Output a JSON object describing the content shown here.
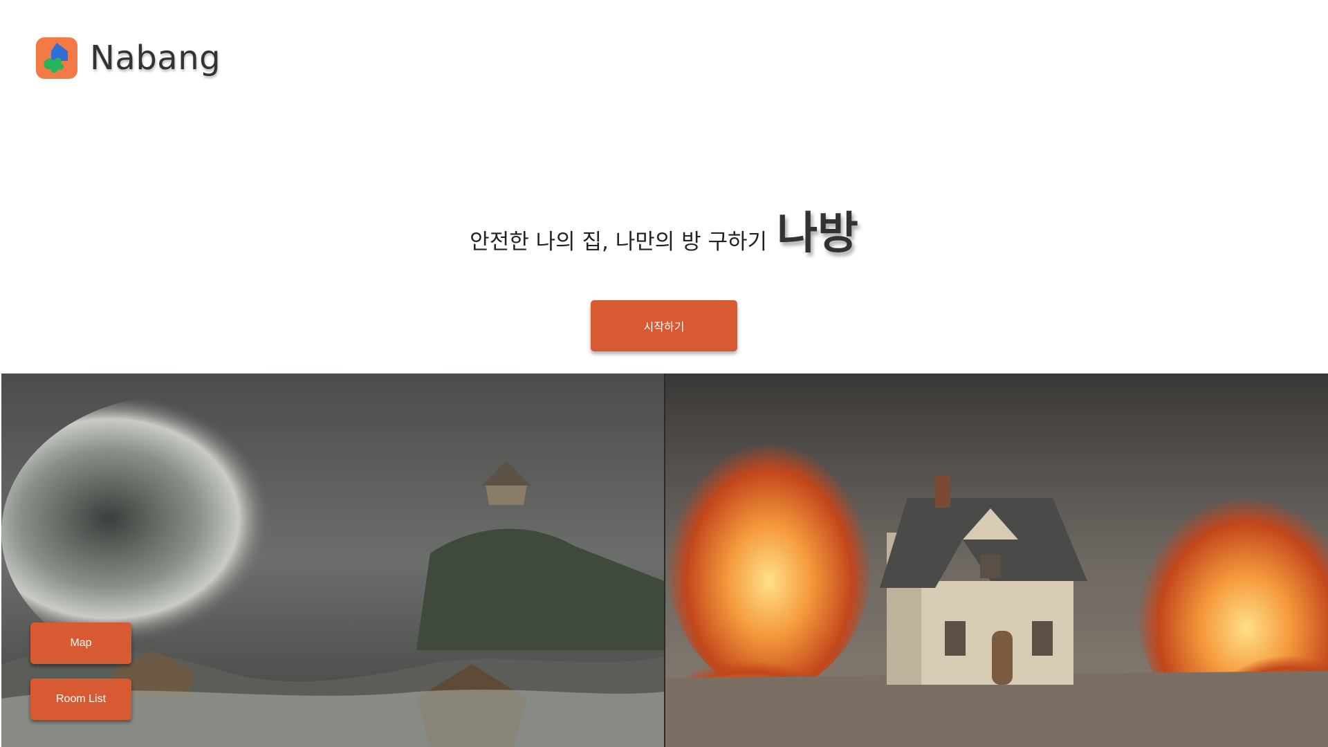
{
  "header": {
    "logo_icon": "house-puzzle-logo-icon",
    "app_name": "Nabang"
  },
  "hero": {
    "tagline": "안전한 나의 집, 나만의 방 구하기",
    "brand_kr": "나방",
    "start_label": "시작하기"
  },
  "gallery": {
    "left_image": "tsunami-wave-house-illustration",
    "right_image": "burning-house-illustration"
  },
  "floating_nav": {
    "map_label": "Map",
    "room_list_label": "Room List"
  },
  "colors": {
    "accent": "#d85a33",
    "logo_bg": "#f47a45"
  }
}
